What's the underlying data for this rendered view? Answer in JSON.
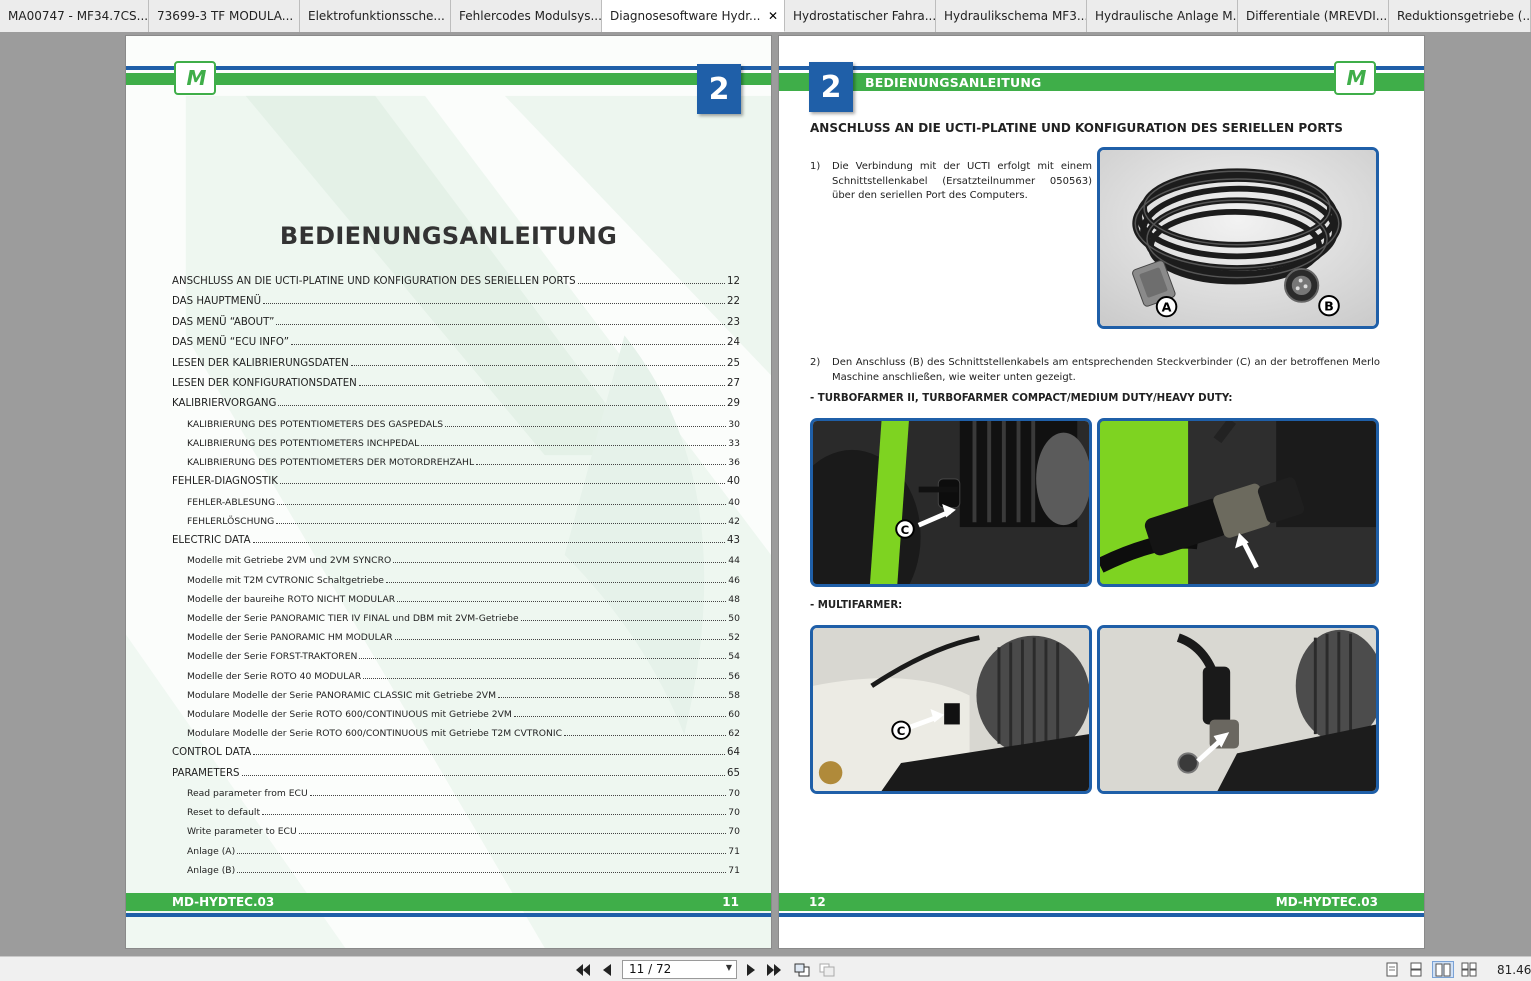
{
  "tabs": [
    {
      "label": "MA00747 - MF34.7CS...",
      "active": false
    },
    {
      "label": "73699-3 TF MODULA...",
      "active": false
    },
    {
      "label": "Elektrofunktionssche...",
      "active": false
    },
    {
      "label": "Fehlercodes Modulsys...",
      "active": false
    },
    {
      "label": "Diagnosesoftware Hydr...",
      "active": true
    },
    {
      "label": "Hydrostatischer Fahra...",
      "active": false
    },
    {
      "label": "Hydraulikschema MF3...",
      "active": false
    },
    {
      "label": "Hydraulische Anlage M...",
      "active": false
    },
    {
      "label": "Differentiale (MREVDI...",
      "active": false
    },
    {
      "label": "Reduktionsgetriebe (...",
      "active": false
    }
  ],
  "close_glyph": "✕",
  "left_page": {
    "logo": "M",
    "chapter": "2",
    "title": "BEDIENUNGSANLEITUNG",
    "toc": [
      {
        "level": 1,
        "title": "ANSCHLUSS AN DIE UCTI-PLATINE UND KONFIGURATION DES SERIELLEN PORTS",
        "page": "12"
      },
      {
        "level": 1,
        "title": "DAS HAUPTMENÜ",
        "page": "22"
      },
      {
        "level": 1,
        "title": "DAS MENÜ “ABOUT”",
        "page": "23"
      },
      {
        "level": 1,
        "title": "DAS MENÜ “ECU INFO”",
        "page": "24"
      },
      {
        "level": 1,
        "title": "LESEN DER KALIBRIERUNGSDATEN",
        "page": "25"
      },
      {
        "level": 1,
        "title": "LESEN DER KONFIGURATIONSDATEN",
        "page": "27"
      },
      {
        "level": 1,
        "title": "KALIBRIERVORGANG",
        "page": "29"
      },
      {
        "level": 2,
        "title": "KALIBRIERUNG DES POTENTIOMETERS DES GASPEDALS",
        "page": "30"
      },
      {
        "level": 2,
        "title": "KALIBRIERUNG DES POTENTIOMETERS INCHPEDAL",
        "page": "33"
      },
      {
        "level": 2,
        "title": "KALIBRIERUNG DES POTENTIOMETERS DER MOTORDREHZAHL",
        "page": "36"
      },
      {
        "level": 1,
        "title": "FEHLER-DIAGNOSTIK",
        "page": "40"
      },
      {
        "level": 2,
        "title": "FEHLER-ABLESUNG",
        "page": "40"
      },
      {
        "level": 2,
        "title": "FEHLERLÖSCHUNG",
        "page": "42"
      },
      {
        "level": 1,
        "title": "ELECTRIC DATA",
        "page": "43"
      },
      {
        "level": 2,
        "title": "Modelle mit Getriebe 2VM und 2VM SYNCRO",
        "page": "44"
      },
      {
        "level": 2,
        "title": "Modelle mit T2M CVTRONIC Schaltgetriebe",
        "page": "46"
      },
      {
        "level": 2,
        "title": "Modelle der baureihe ROTO NICHT MODULAR",
        "page": "48"
      },
      {
        "level": 2,
        "title": "Modelle der Serie PANORAMIC TIER IV FINAL und DBM mit 2VM-Getriebe",
        "page": "50"
      },
      {
        "level": 2,
        "title": "Modelle der Serie PANORAMIC HM MODULAR",
        "page": "52"
      },
      {
        "level": 2,
        "title": "Modelle der Serie FORST-TRAKTOREN",
        "page": "54"
      },
      {
        "level": 2,
        "title": "Modelle der Serie ROTO 40 MODULAR",
        "page": "56"
      },
      {
        "level": 2,
        "title": "Modulare Modelle der Serie PANORAMIC CLASSIC mit Getriebe 2VM",
        "page": "58"
      },
      {
        "level": 2,
        "title": "Modulare Modelle der Serie ROTO 600/CONTINUOUS mit Getriebe 2VM",
        "page": "60"
      },
      {
        "level": 2,
        "title": "Modulare Modelle der Serie ROTO 600/CONTINUOUS mit Getriebe T2M CVTRONIC",
        "page": "62"
      },
      {
        "level": 1,
        "title": "CONTROL DATA",
        "page": "64"
      },
      {
        "level": 1,
        "title": "PARAMETERS",
        "page": "65"
      },
      {
        "level": 2,
        "title": "Read parameter from ECU",
        "page": "70"
      },
      {
        "level": 2,
        "title": "Reset to default",
        "page": "70"
      },
      {
        "level": 2,
        "title": "Write parameter to ECU",
        "page": "70"
      },
      {
        "level": 2,
        "title": "Anlage (A)",
        "page": "71"
      },
      {
        "level": 2,
        "title": "Anlage (B)",
        "page": "71"
      }
    ],
    "footer_left": "MD-HYDTEC.03",
    "footer_right": "11"
  },
  "right_page": {
    "logo": "M",
    "chapter": "2",
    "header_title": "BEDIENUNGSANLEITUNG",
    "section_title": "ANSCHLUSS AN DIE UCTI-PLATINE UND KONFIGURATION DES SERIELLEN PORTS",
    "step1_num": "1)",
    "step1_text": "Die Verbindung mit der UCTI erfolgt mit einem Schnittstellenkabel (Ersatzteilnummer 050563) über den seriellen Port des Computers.",
    "label_a": "A",
    "label_b": "B",
    "step2_num": "2)",
    "step2_text": "Den Anschluss (B) des Schnittstellenkabels am entsprechenden Steckverbinder (C) an der betroffenen Merlo Maschine anschließen, wie weiter unten gezeigt.",
    "subhead1": "- TURBOFARMER II, TURBOFARMER COMPACT/MEDIUM DUTY/HEAVY DUTY:",
    "subhead2": "- MULTIFARMER:",
    "label_c": "C",
    "footer_left": "12",
    "footer_right": "MD-HYDTEC.03"
  },
  "toolbar": {
    "page_indicator": "11 / 72",
    "zoom": "81.46"
  },
  "colors": {
    "brand_green": "#3fae49",
    "brand_blue": "#1f5fa8",
    "photo_green": "#7ed321"
  }
}
